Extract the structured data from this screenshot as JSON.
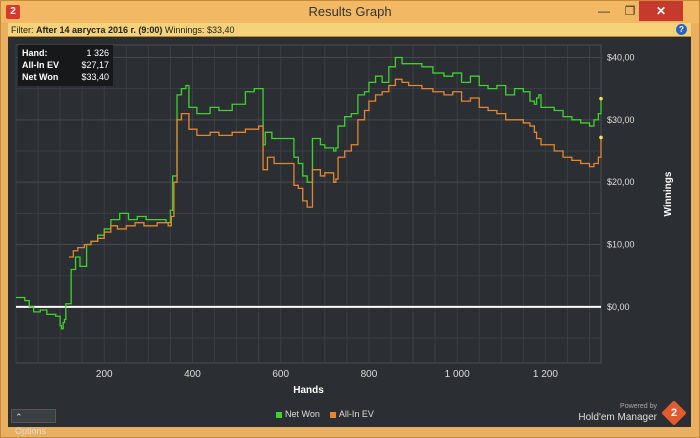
{
  "window": {
    "title": "Results Graph",
    "app_icon": "2",
    "minimize_glyph": "—",
    "maximize_glyph": "❐",
    "close_glyph": "✕"
  },
  "filter": {
    "prefix": "Filter:",
    "text": "After 14 августа 2016 г. (9:00)",
    "winnings": "Winnings: $33,40"
  },
  "stats": {
    "hands_label": "Hand:",
    "hands_value": "1 326",
    "allin_label": "All-In EV",
    "allin_value": "$27,17",
    "netwon_label": "Net Won",
    "netwon_value": "$33,40"
  },
  "chart_data": {
    "type": "line",
    "xlabel": "Hands",
    "ylabel": "Winnings",
    "xlim": [
      0,
      1326
    ],
    "ylim": [
      -9,
      42
    ],
    "x_ticks": [
      200,
      400,
      600,
      800,
      1000,
      1200
    ],
    "x_tick_labels": [
      "200",
      "400",
      "600",
      "800",
      "1 000",
      "1 200"
    ],
    "y_ticks": [
      0,
      10,
      20,
      30,
      40
    ],
    "y_tick_labels": [
      "$0,00",
      "$10,00",
      "$20,00",
      "$30,00",
      "$40,00"
    ],
    "grid": true,
    "series": [
      {
        "name": "Net Won",
        "color": "#3fd12f",
        "points": [
          [
            0,
            1.5
          ],
          [
            20,
            1.0
          ],
          [
            30,
            0.0
          ],
          [
            40,
            -0.8
          ],
          [
            55,
            -0.5
          ],
          [
            70,
            -1.2
          ],
          [
            90,
            -1.5
          ],
          [
            100,
            -3.0
          ],
          [
            103,
            -3.5
          ],
          [
            107,
            -2.5
          ],
          [
            110,
            -2.0
          ],
          [
            113,
            0.5
          ],
          [
            125,
            6.0
          ],
          [
            135,
            8.0
          ],
          [
            145,
            6.5
          ],
          [
            160,
            10.0
          ],
          [
            170,
            10.5
          ],
          [
            185,
            11.5
          ],
          [
            200,
            12.5
          ],
          [
            215,
            14.0
          ],
          [
            235,
            15.0
          ],
          [
            255,
            14.0
          ],
          [
            275,
            14.5
          ],
          [
            295,
            14.0
          ],
          [
            320,
            14.0
          ],
          [
            340,
            13.5
          ],
          [
            350,
            15.5
          ],
          [
            355,
            21.0
          ],
          [
            365,
            34.0
          ],
          [
            375,
            35.0
          ],
          [
            385,
            35.5
          ],
          [
            392,
            32.0
          ],
          [
            410,
            31.0
          ],
          [
            440,
            32.0
          ],
          [
            460,
            31.5
          ],
          [
            490,
            32.5
          ],
          [
            520,
            34.5
          ],
          [
            540,
            35.0
          ],
          [
            555,
            35.0
          ],
          [
            560,
            26.0
          ],
          [
            565,
            28.0
          ],
          [
            580,
            27.0
          ],
          [
            600,
            27.0
          ],
          [
            620,
            27.0
          ],
          [
            630,
            24.0
          ],
          [
            640,
            23.0
          ],
          [
            650,
            21.0
          ],
          [
            660,
            20.0
          ],
          [
            672,
            27.0
          ],
          [
            690,
            26.0
          ],
          [
            700,
            25.5
          ],
          [
            720,
            25.0
          ],
          [
            725,
            25.5
          ],
          [
            730,
            29.0
          ],
          [
            745,
            30.5
          ],
          [
            760,
            31.0
          ],
          [
            775,
            34.0
          ],
          [
            790,
            34.5
          ],
          [
            800,
            36.0
          ],
          [
            815,
            37.0
          ],
          [
            830,
            36.0
          ],
          [
            845,
            38.5
          ],
          [
            860,
            40.0
          ],
          [
            875,
            39.0
          ],
          [
            890,
            39.0
          ],
          [
            920,
            38.5
          ],
          [
            945,
            37.5
          ],
          [
            970,
            37.0
          ],
          [
            990,
            37.5
          ],
          [
            1010,
            36.0
          ],
          [
            1030,
            37.0
          ],
          [
            1050,
            35.5
          ],
          [
            1070,
            35.0
          ],
          [
            1090,
            35.5
          ],
          [
            1110,
            34.0
          ],
          [
            1130,
            35.0
          ],
          [
            1150,
            34.5
          ],
          [
            1165,
            33.0
          ],
          [
            1175,
            32.5
          ],
          [
            1180,
            33.5
          ],
          [
            1185,
            34.0
          ],
          [
            1190,
            32.0
          ],
          [
            1200,
            32.0
          ],
          [
            1220,
            31.5
          ],
          [
            1240,
            30.5
          ],
          [
            1260,
            30.0
          ],
          [
            1280,
            29.5
          ],
          [
            1300,
            29.0
          ],
          [
            1310,
            30.0
          ],
          [
            1320,
            31.0
          ],
          [
            1326,
            33.4
          ]
        ]
      },
      {
        "name": "All-In EV",
        "color": "#e3862f",
        "points": [
          [
            120,
            8.0
          ],
          [
            130,
            9.0
          ],
          [
            140,
            9.5
          ],
          [
            155,
            10.0
          ],
          [
            170,
            10.5
          ],
          [
            185,
            11.0
          ],
          [
            200,
            12.0
          ],
          [
            215,
            13.0
          ],
          [
            230,
            12.5
          ],
          [
            250,
            13.0
          ],
          [
            270,
            13.5
          ],
          [
            290,
            13.0
          ],
          [
            320,
            13.5
          ],
          [
            345,
            13.0
          ],
          [
            352,
            14.5
          ],
          [
            358,
            20.0
          ],
          [
            365,
            30.0
          ],
          [
            375,
            31.0
          ],
          [
            385,
            31.0
          ],
          [
            392,
            28.5
          ],
          [
            410,
            27.5
          ],
          [
            440,
            28.0
          ],
          [
            460,
            27.5
          ],
          [
            490,
            28.0
          ],
          [
            520,
            28.5
          ],
          [
            550,
            29.0
          ],
          [
            560,
            22.0
          ],
          [
            570,
            24.0
          ],
          [
            585,
            23.0
          ],
          [
            600,
            23.0
          ],
          [
            620,
            23.0
          ],
          [
            630,
            19.5
          ],
          [
            640,
            19.0
          ],
          [
            650,
            17.0
          ],
          [
            660,
            16.0
          ],
          [
            672,
            22.0
          ],
          [
            690,
            21.0
          ],
          [
            700,
            21.5
          ],
          [
            720,
            20.0
          ],
          [
            725,
            20.5
          ],
          [
            730,
            24.0
          ],
          [
            745,
            25.0
          ],
          [
            760,
            26.0
          ],
          [
            775,
            30.0
          ],
          [
            790,
            31.5
          ],
          [
            800,
            33.0
          ],
          [
            815,
            34.0
          ],
          [
            830,
            34.5
          ],
          [
            845,
            35.5
          ],
          [
            860,
            36.5
          ],
          [
            875,
            36.0
          ],
          [
            890,
            35.5
          ],
          [
            920,
            35.0
          ],
          [
            945,
            34.5
          ],
          [
            970,
            34.0
          ],
          [
            990,
            34.5
          ],
          [
            1010,
            33.0
          ],
          [
            1030,
            33.5
          ],
          [
            1050,
            32.0
          ],
          [
            1070,
            31.5
          ],
          [
            1090,
            31.0
          ],
          [
            1110,
            30.0
          ],
          [
            1130,
            30.0
          ],
          [
            1150,
            29.5
          ],
          [
            1165,
            29.0
          ],
          [
            1175,
            28.0
          ],
          [
            1180,
            27.0
          ],
          [
            1190,
            26.0
          ],
          [
            1200,
            26.0
          ],
          [
            1220,
            25.0
          ],
          [
            1240,
            24.0
          ],
          [
            1260,
            23.5
          ],
          [
            1280,
            23.0
          ],
          [
            1300,
            22.5
          ],
          [
            1310,
            23.0
          ],
          [
            1320,
            24.0
          ],
          [
            1326,
            27.17
          ]
        ]
      }
    ]
  },
  "legend": {
    "netwon": "Net Won",
    "allin": "All-In EV"
  },
  "footer": {
    "options_label": "Options",
    "powered_by": "Powered by",
    "brand": "Hold'em Manager",
    "brand_logo": "2"
  }
}
